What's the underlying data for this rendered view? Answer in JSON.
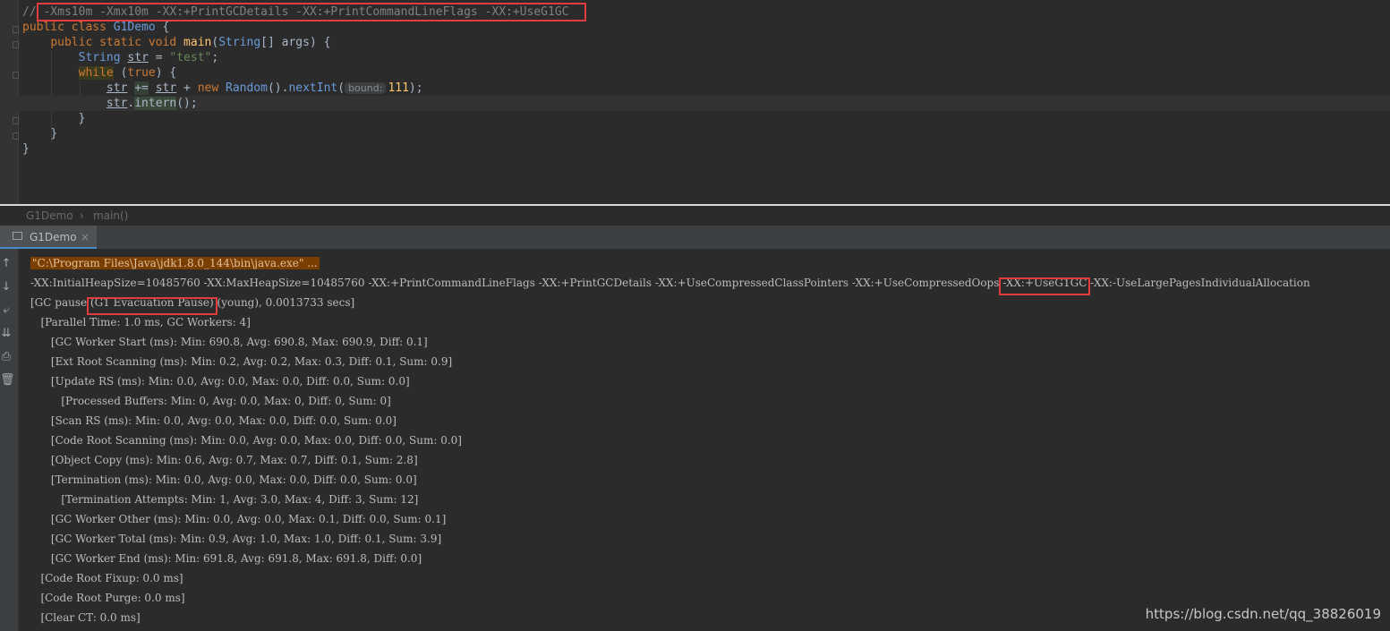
{
  "editor": {
    "comment_prefix": "// ",
    "jvm_flags": "-Xms10m -Xmx10m -XX:+PrintGCDetails -XX:+PrintCommandLineFlags -XX:+UseG1GC",
    "class_line": {
      "kw1": "public",
      "kw2": "class",
      "name": "G1Demo",
      "rest": " {"
    },
    "main_line": {
      "kw1": "public",
      "kw2": "static",
      "kw3": "void",
      "fn": "main",
      "p_open": "(",
      "type": "String",
      "rest": "[] args) {"
    },
    "str_line": {
      "type": "String",
      "var": "str",
      "eq": " = ",
      "value": "\"test\"",
      "end": ";"
    },
    "while_line": {
      "kw": "while",
      "sp": " (",
      "cond": "true",
      "rest": ") {"
    },
    "assign_line": {
      "var": "str",
      "op": "+=",
      "var2": "str",
      "plus": " + ",
      "new": "new",
      "type": "Random",
      "call": "().",
      "fn": "nextInt",
      "po": "(",
      "hint": "bound:",
      "num": "111",
      "end": ");"
    },
    "intern_line": {
      "var": "str",
      "dot": ".",
      "fn": "intern",
      "end": "();"
    },
    "close1": "}",
    "close2": "}",
    "close3": "}"
  },
  "breadcrumb": {
    "class": "G1Demo",
    "sep": "›",
    "method": "main()"
  },
  "run_tab": {
    "label": "G1Demo",
    "close": "×"
  },
  "console": {
    "cmd": "\"C:\\Program Files\\Java\\jdk1.8.0_144\\bin\\java.exe\" ...",
    "flags_line": {
      "pre": "-XX:InitialHeapSize=10485760 -XX:MaxHeapSize=10485760 -XX:+PrintCommandLineFlags -XX:+PrintGCDetails -XX:+UseCompressedClassPointers -XX:+UseCompressedOops ",
      "hl": "-XX:+UseG1GC",
      "post": " -XX:-UseLargePagesIndividualAllocation"
    },
    "gc_line": {
      "pre": "[GC pause ",
      "hl": "(G1 Evacuation Pause)",
      "post": " (young), 0.0013733 secs]"
    },
    "lines": [
      "   [Parallel Time: 1.0 ms, GC Workers: 4]",
      "      [GC Worker Start (ms): Min: 690.8, Avg: 690.8, Max: 690.9, Diff: 0.1]",
      "      [Ext Root Scanning (ms): Min: 0.2, Avg: 0.2, Max: 0.3, Diff: 0.1, Sum: 0.9]",
      "      [Update RS (ms): Min: 0.0, Avg: 0.0, Max: 0.0, Diff: 0.0, Sum: 0.0]",
      "         [Processed Buffers: Min: 0, Avg: 0.0, Max: 0, Diff: 0, Sum: 0]",
      "      [Scan RS (ms): Min: 0.0, Avg: 0.0, Max: 0.0, Diff: 0.0, Sum: 0.0]",
      "      [Code Root Scanning (ms): Min: 0.0, Avg: 0.0, Max: 0.0, Diff: 0.0, Sum: 0.0]",
      "      [Object Copy (ms): Min: 0.6, Avg: 0.7, Max: 0.7, Diff: 0.1, Sum: 2.8]",
      "      [Termination (ms): Min: 0.0, Avg: 0.0, Max: 0.0, Diff: 0.0, Sum: 0.0]",
      "         [Termination Attempts: Min: 1, Avg: 3.0, Max: 4, Diff: 3, Sum: 12]",
      "      [GC Worker Other (ms): Min: 0.0, Avg: 0.0, Max: 0.1, Diff: 0.0, Sum: 0.1]",
      "      [GC Worker Total (ms): Min: 0.9, Avg: 1.0, Max: 1.0, Diff: 0.1, Sum: 3.9]",
      "      [GC Worker End (ms): Min: 691.8, Avg: 691.8, Max: 691.8, Diff: 0.0]",
      "   [Code Root Fixup: 0.0 ms]",
      "   [Code Root Purge: 0.0 ms]",
      "   [Clear CT: 0.0 ms]"
    ]
  },
  "watermark": "https://blog.csdn.net/qq_38826019",
  "colors": {
    "highlight_box": "#e23d3d",
    "keyword": "#cc7832",
    "string": "#6a8759",
    "number": "#6897bb",
    "function": "#ffc66d"
  }
}
